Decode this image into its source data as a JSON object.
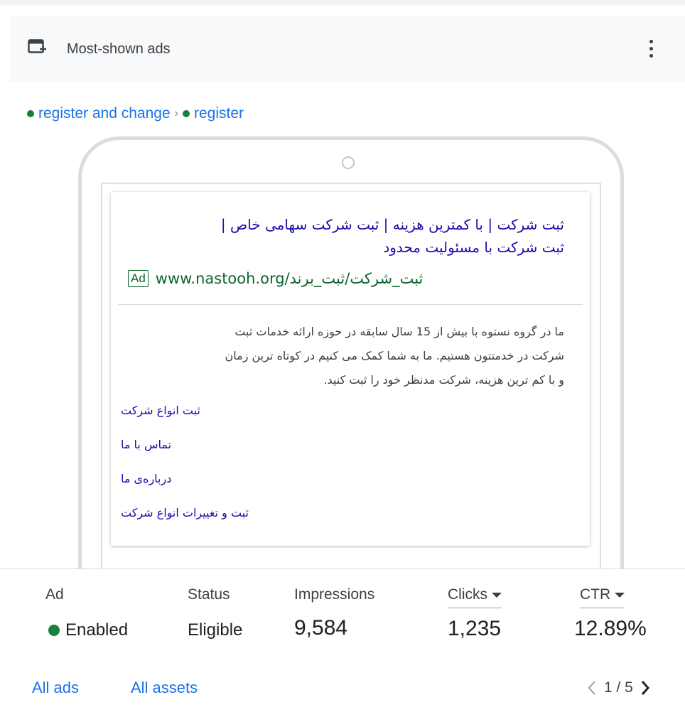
{
  "header": {
    "title": "Most-shown ads",
    "menu_icon": "more-vert-icon"
  },
  "breadcrumb": {
    "campaign": "register and change",
    "separator": "›",
    "ad_group": "register"
  },
  "ad": {
    "headline_line1": "ثبت شرکت | با کمترین هزینه | ثبت شرکت سهامی خاص |",
    "headline_line2": "ثبت شرکت با مسئولیت محدود",
    "badge": "Ad",
    "display_url": "www.nastooh.org/ثبت_شرکت/ثبت_برند",
    "description_line1": "ما در گروه نستوه با بیش از 15 سال سابقه در حوزه ارائه خدمات ثبت",
    "description_line2": "شرکت در خدمتتون هستیم. ما به شما کمک می کنیم در کوتاه ترین زمان",
    "description_line3": "و با کم ترین هزینه، شرکت مدنظر خود را ثبت کنید.",
    "sitelinks": [
      "ثبت انواع شرکت",
      "تماس با ما",
      "درباره‌ی ما",
      "ثبت و تغییرات انواع شرکت"
    ]
  },
  "stats": {
    "ad_label": "Ad",
    "ad_value": "Enabled",
    "status_label": "Status",
    "status_value": "Eligible",
    "impressions_label": "Impressions",
    "impressions_value": "9,584",
    "clicks_label": "Clicks",
    "clicks_value": "1,235",
    "ctr_label": "CTR",
    "ctr_value": "12.89%"
  },
  "footer": {
    "all_ads": "All ads",
    "all_assets": "All assets",
    "page_indicator": "1 / 5"
  },
  "colors": {
    "accent": "#1a73e8",
    "enabled_green": "#188038",
    "ad_url_green": "#0d652d",
    "headline_purple": "#1a0dab"
  }
}
